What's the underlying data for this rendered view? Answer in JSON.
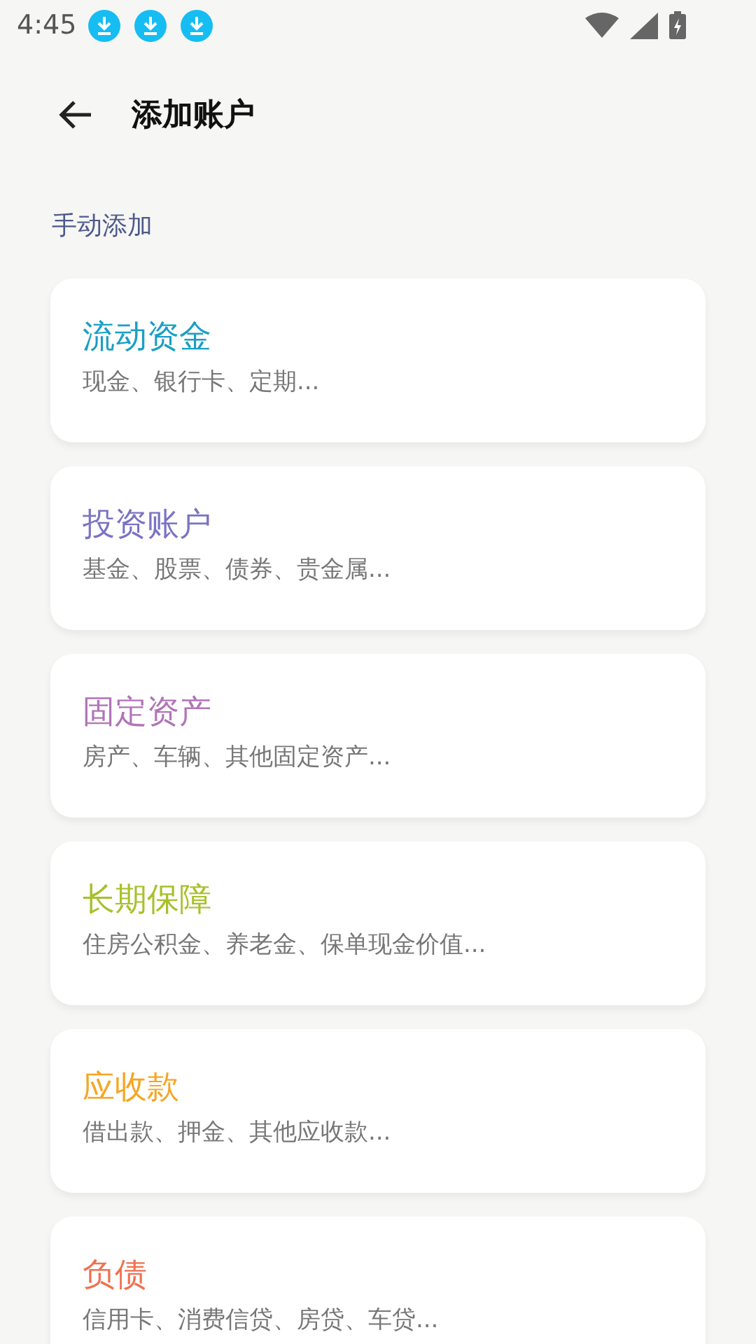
{
  "status_bar": {
    "time": "4:45",
    "notifications": [
      {
        "kind": "download"
      },
      {
        "kind": "download"
      },
      {
        "kind": "download"
      }
    ]
  },
  "header": {
    "title": "添加账户"
  },
  "section": {
    "title": "手动添加"
  },
  "categories": [
    {
      "title": "流动资金",
      "subtitle": "现金、银行卡、定期...",
      "color": "#1a9fc4"
    },
    {
      "title": "投资账户",
      "subtitle": "基金、股票、债券、贵金属...",
      "color": "#7a73c4"
    },
    {
      "title": "固定资产",
      "subtitle": "房产、车辆、其他固定资产...",
      "color": "#b174b8"
    },
    {
      "title": "长期保障",
      "subtitle": "住房公积金、养老金、保单现金价值...",
      "color": "#a8c02a"
    },
    {
      "title": "应收款",
      "subtitle": "借出款、押金、其他应收款...",
      "color": "#f5a623"
    },
    {
      "title": "负债",
      "subtitle": "信用卡、消费信贷、房贷、车贷...",
      "color": "#f0714f"
    }
  ]
}
